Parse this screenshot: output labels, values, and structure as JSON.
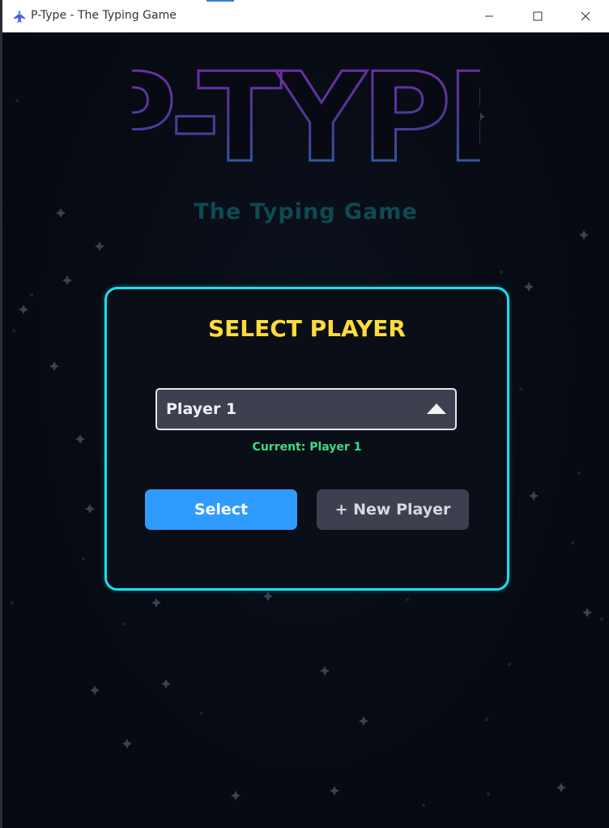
{
  "window": {
    "title": "P-Type - The Typing Game",
    "icon": "rocket-icon",
    "controls": [
      "minimize-icon",
      "maximize-icon",
      "close-icon"
    ]
  },
  "game": {
    "logo_text": "P-TYPE",
    "subtitle": "The Typing Game",
    "panel": {
      "title": "SELECT PLAYER",
      "player_dropdown": {
        "selected": "Player 1",
        "arrow_icon": "triangle-up-icon"
      },
      "current_label": "Current: Player 1",
      "select_button": "Select",
      "new_player_button": "+ New Player"
    }
  },
  "colors": {
    "background": "#05080f",
    "panel_border": "#18e0ee",
    "panel_title": "#ffdc3a",
    "current_text": "#3ddc84",
    "select_button": "#2f9bff",
    "secondary_button": "#3d414f",
    "logo_top": "#7a2aa8",
    "logo_bottom": "#1d6fa0",
    "subtitle": "#0f4a52"
  }
}
